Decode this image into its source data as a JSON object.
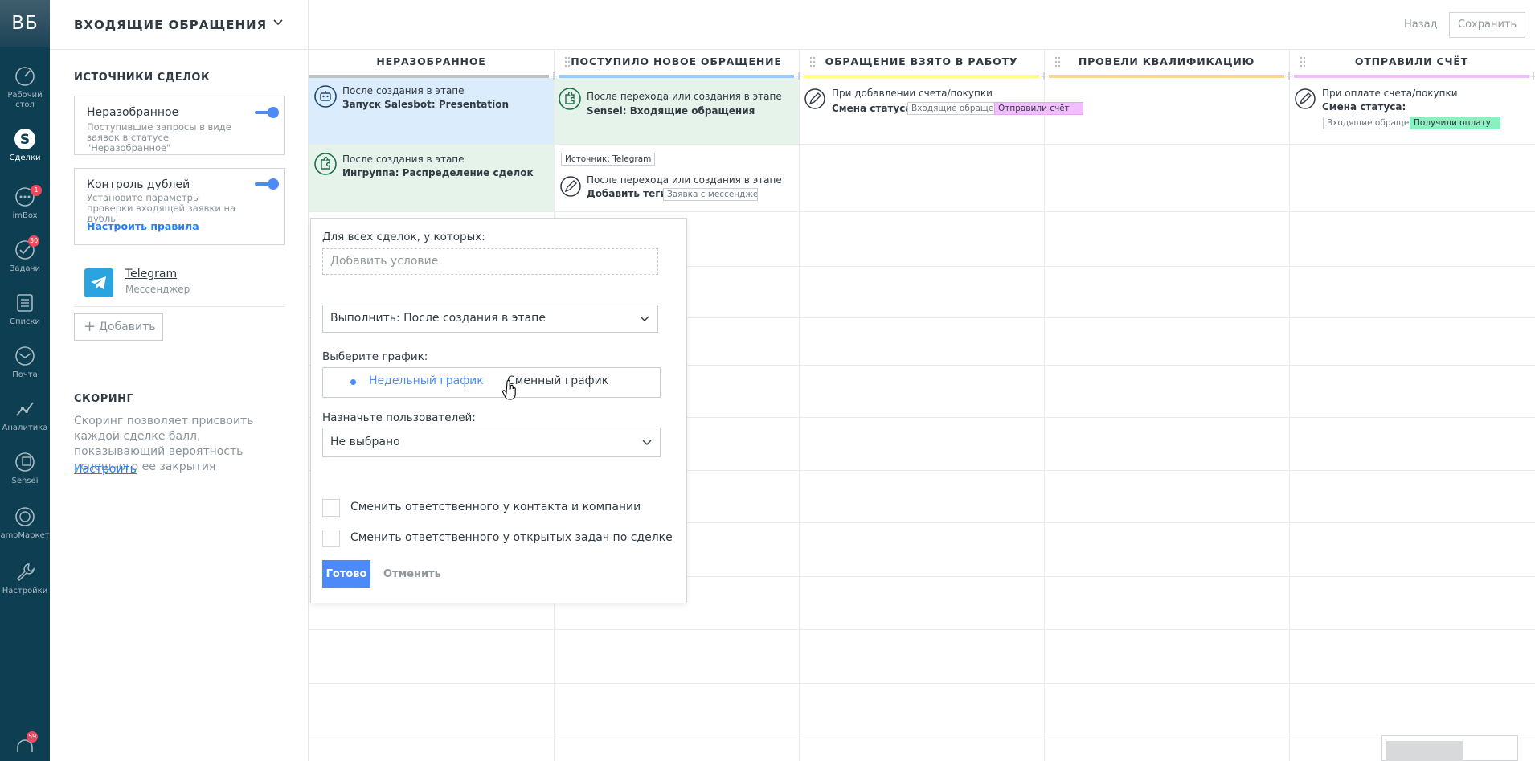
{
  "nav": {
    "logo": "ВБ",
    "items": [
      {
        "label_1": "Рабочий",
        "label_2": "стол"
      },
      {
        "label": "Сделки"
      },
      {
        "label": "imBox",
        "badge": "1"
      },
      {
        "label": "Задачи",
        "badge": "30"
      },
      {
        "label": "Списки"
      },
      {
        "label": "Почта"
      },
      {
        "label": "Аналитика"
      },
      {
        "label": "Sensei"
      },
      {
        "label": "amoМаркет"
      },
      {
        "label": "Настройки"
      }
    ],
    "bottom_badge": "59"
  },
  "panel": {
    "pipeline_title": "ВХОДЯЩИЕ ОБРАЩЕНИЯ",
    "sources_title": "ИСТОЧНИКИ СДЕЛОК",
    "unsorted": {
      "name": "Неразобранное",
      "desc": "Поступившие запросы в виде заявок в статусе \"Неразобранное\"",
      "enabled": true
    },
    "duplicates": {
      "name": "Контроль дублей",
      "desc": "Установите параметры проверки входящей заявки на дубль",
      "link": "Настроить правила",
      "enabled": true
    },
    "telegram": {
      "name": "Telegram",
      "sub": "Мессенджер"
    },
    "add_button": "Добавить",
    "scoring_title": "СКОРИНГ",
    "scoring_desc": "Скоринг позволяет присвоить каждой сделке балл, показывающий вероятность успешного ее закрытия",
    "scoring_link": "Настроить"
  },
  "topbar": {
    "back": "Назад",
    "save": "Сохранить"
  },
  "columns": [
    {
      "title": "НЕРАЗОБРАННОЕ",
      "color": "#bfc3c6"
    },
    {
      "title": "ПОСТУПИЛО НОВОЕ ОБРАЩЕНИЕ",
      "color": "#99ccfd"
    },
    {
      "title": "ОБРАЩЕНИЕ ВЗЯТО В РАБОТУ",
      "color": "#fffd7f"
    },
    {
      "title": "ПРОВЕЛИ КВАЛИФИКАЦИЮ",
      "color": "#fbd691"
    },
    {
      "title": "ОТПРАВИЛИ СЧЁТ",
      "color": "#f3beff"
    }
  ],
  "triggers": {
    "t1": {
      "when": "После создания в этапе",
      "what": "Запуск Salesbot: Presentation"
    },
    "t2": {
      "when": "После создания в этапе",
      "what": "Ингруппа: Распределение сделок"
    },
    "t3": {
      "when": "После перехода или создания в этапе",
      "what": "Sensei: Входящие обращения"
    },
    "t4": {
      "source": "Источник: Telegram",
      "when": "После перехода или создания в этапе",
      "what": "Добавить теги:",
      "tag": "Заявка с мессенджер"
    },
    "t5": {
      "when": "При добавлении счета/покупки",
      "what": "Смена статуса:",
      "from": "Входящие обращен",
      "to": "Отправили счёт"
    },
    "t6": {
      "when": "При оплате счета/покупки",
      "what": "Смена статуса:",
      "from": "Входящие обращен",
      "to": "Получили оплату"
    }
  },
  "modal": {
    "cond_label": "Для всех сделок, у которых:",
    "cond_placeholder": "Добавить условие",
    "exec_value": "Выполнить: После создания в этапе",
    "schedule_label": "Выберите график:",
    "schedule_weekly": "Недельный график",
    "schedule_shift": "Сменный график",
    "users_label": "Назначьте пользователей:",
    "users_value": "Не выбрано",
    "check1": "Сменить ответственного у контакта и компании",
    "check2": "Сменить ответственного у открытых задач по сделке",
    "done": "Готово",
    "cancel": "Отменить"
  }
}
